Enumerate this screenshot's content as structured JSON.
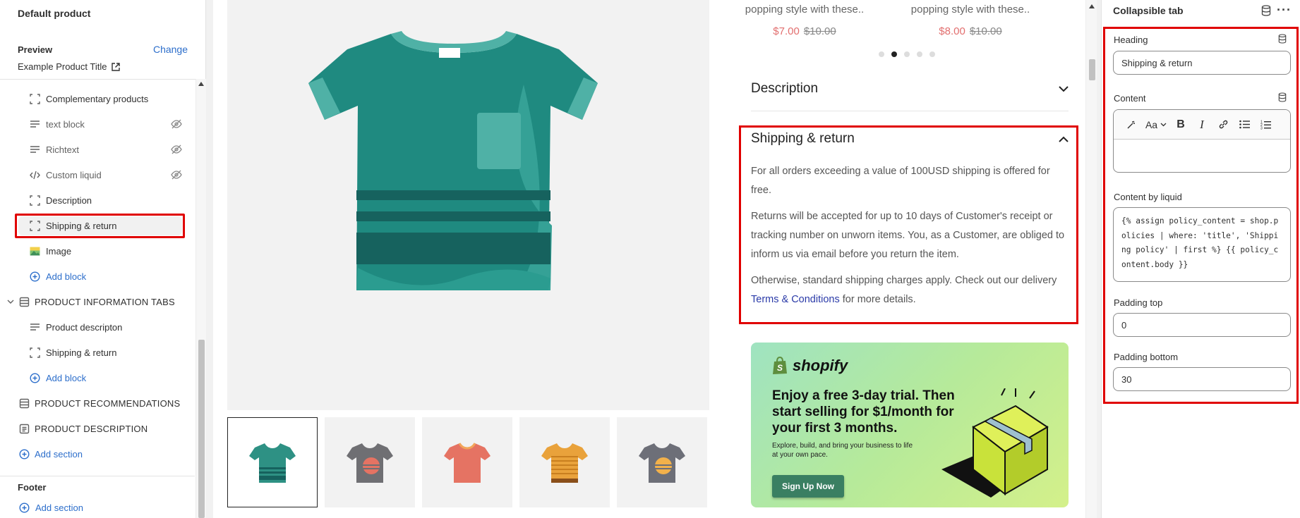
{
  "sidebar": {
    "title": "Default product",
    "preview_label": "Preview",
    "change_label": "Change",
    "product_title": "Example Product Title",
    "items": [
      {
        "label": "Complementary products",
        "icon": "block-dashed-icon"
      },
      {
        "label": "text block",
        "icon": "text-lines-icon",
        "hidden": true
      },
      {
        "label": "Richtext",
        "icon": "text-lines-icon",
        "hidden": true
      },
      {
        "label": "Custom liquid",
        "icon": "code-icon",
        "hidden": true
      },
      {
        "label": "Description",
        "icon": "block-dashed-icon"
      },
      {
        "label": "Shipping & return",
        "icon": "block-dashed-icon"
      },
      {
        "label": "Image",
        "icon": "image-icon"
      },
      {
        "label": "Add block",
        "icon": "plus-circle-icon"
      }
    ],
    "sections": [
      {
        "label": "PRODUCT INFORMATION TABS"
      },
      {
        "label": "PRODUCT RECOMMENDATIONS"
      },
      {
        "label": "PRODUCT DESCRIPTION"
      }
    ],
    "tab_items": [
      {
        "label": "Product descripton"
      },
      {
        "label": "Shipping & return"
      },
      {
        "label": "Add block"
      }
    ],
    "add_section": "Add section",
    "footer_label": "Footer",
    "footer_add_section": "Add section"
  },
  "preview": {
    "related": [
      {
        "name": "popping style with these..",
        "price": "$7.00",
        "old_price": "$10.00"
      },
      {
        "name": "popping style with these..",
        "price": "$8.00",
        "old_price": "$10.00"
      }
    ],
    "description_heading": "Description",
    "shipping_heading": "Shipping & return",
    "shipping_p1": "For all orders exceeding a value of 100USD shipping is offered for free.",
    "shipping_p2": "Returns will be accepted for up to 10 days of Customer's receipt or tracking number on unworn items. You, as a Customer, are obliged to inform us via email before you return the item.",
    "shipping_p3_pre": "Otherwise, standard shipping charges apply. Check out our delivery ",
    "shipping_p3_link": "Terms & Conditions",
    "shipping_p3_post": " for more details.",
    "ad": {
      "brand": "shopify",
      "headline": "Enjoy a free 3-day trial. Then start selling for $1/month for your first 3 months.",
      "sub": "Explore, build, and bring your business to life at your own pace.",
      "button": "Sign Up Now"
    },
    "thumb_colors": [
      "#2e9184",
      "#6f6f73",
      "#e57363",
      "#e9a23b",
      "#6d6f78"
    ],
    "accent_colors": {
      "sale": "#e26f6f",
      "link": "#2a3aa8",
      "highlight": "#e00000"
    }
  },
  "panel": {
    "title": "Collapsible tab",
    "heading_label": "Heading",
    "heading_value": "Shipping & return",
    "content_label": "Content",
    "content_by_liquid_label": "Content by liquid",
    "liquid_value": "{% assign policy_content = shop.policies | where: 'title', 'Shipping policy' | first %} {{ policy_content.body }}",
    "padding_top_label": "Padding top",
    "padding_top_value": "0",
    "padding_bottom_label": "Padding bottom",
    "padding_bottom_value": "30"
  }
}
